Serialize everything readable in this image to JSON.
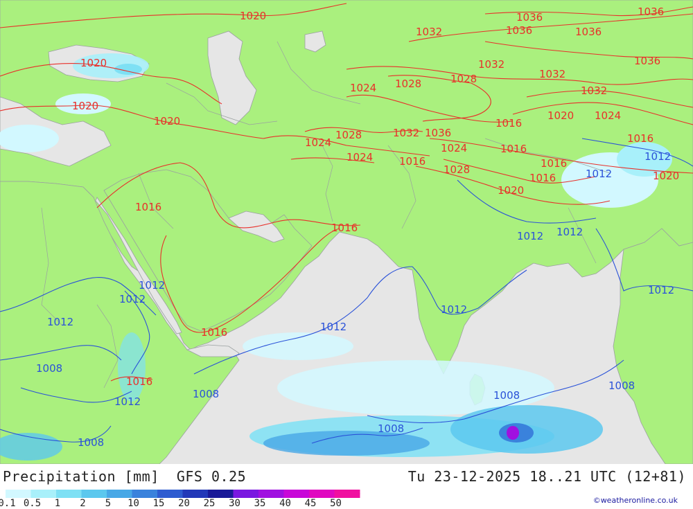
{
  "title": {
    "left": "Precipitation [mm]  GFS 0.25",
    "right": "Tu 23-12-2025 18..21 UTC (12+81)"
  },
  "credit": "©weatheronline.co.uk",
  "legend": {
    "ticks": [
      "0.1",
      "0.5",
      "1",
      "2",
      "5",
      "10",
      "15",
      "20",
      "25",
      "30",
      "35",
      "40",
      "45",
      "50"
    ],
    "colors": [
      "#d2f8ff",
      "#a8f0fa",
      "#7ee0f4",
      "#5cc8ee",
      "#48a8e6",
      "#3a82dc",
      "#2e5cd0",
      "#2238b8",
      "#1a1a98",
      "#7a18e0",
      "#a010e0",
      "#c808d8",
      "#e008c0",
      "#f010a0"
    ]
  },
  "map_colors": {
    "sea": "#e6e6e6",
    "land": "#aaf07e",
    "isobar_high": "#e8302a",
    "isobar_low": "#2a52d8"
  },
  "isobar_labels": {
    "red": [
      "1020",
      "1020",
      "1020",
      "1020",
      "1032",
      "1036",
      "1036",
      "1036",
      "1036",
      "1036",
      "1032",
      "1032",
      "1028",
      "1028",
      "1024",
      "1032",
      "1020",
      "1024",
      "1016",
      "1024",
      "1028",
      "1032",
      "1036",
      "1024",
      "1028",
      "1016",
      "1016",
      "1016",
      "1020",
      "1016",
      "1016",
      "1016",
      "1020",
      "1016",
      "1024",
      "1016"
    ],
    "blue": [
      "1012",
      "1012",
      "1012",
      "1012",
      "1012",
      "1012",
      "1012",
      "1012",
      "1012",
      "1012",
      "1008",
      "1012",
      "1008",
      "1008",
      "1008"
    ]
  }
}
